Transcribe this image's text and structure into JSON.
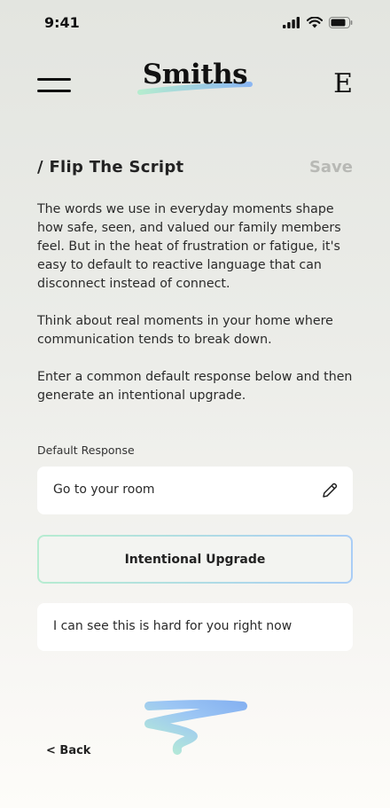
{
  "status_bar": {
    "time": "9:41"
  },
  "header": {
    "brand": "Smiths",
    "profile_initial": "E"
  },
  "page": {
    "title": "/ Flip The Script",
    "save_label": "Save"
  },
  "intro": {
    "paragraphs": [
      "The words we use in everyday moments shape how safe, seen, and valued our family members feel. But in the heat of frustration or fatigue, it's easy to default to reactive language that can disconnect instead of connect.",
      "Think about real moments in your home where communication tends to break down.",
      "Enter a common default response below and then generate an intentional upgrade."
    ]
  },
  "form": {
    "default_label": "Default Response",
    "default_value": "Go to your room",
    "upgrade_button_label": "Intentional Upgrade",
    "upgrade_result": "I can see this is hard for you right now"
  },
  "footer": {
    "back_label": "< Back"
  },
  "colors": {
    "accent_green": "#b7ecd1",
    "accent_blue": "#a9cdf6",
    "save_disabled": "#b8b9b5"
  }
}
